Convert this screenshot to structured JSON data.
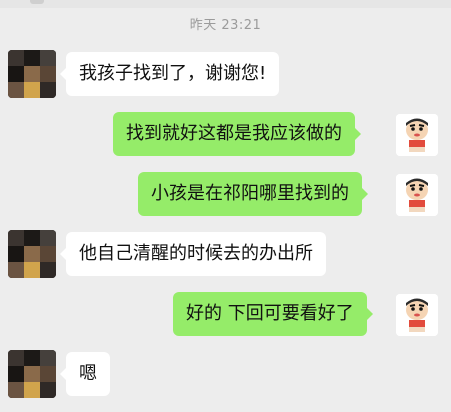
{
  "chat": {
    "timestamp": "昨天 23:21",
    "messages": [
      {
        "side": "in",
        "text": "我孩子找到了，谢谢您!"
      },
      {
        "side": "out",
        "text": "找到就好这都是我应该做的"
      },
      {
        "side": "out",
        "text": "小孩是在祁阳哪里找到的"
      },
      {
        "side": "in",
        "text": "他自己清醒的时候去的办出所"
      },
      {
        "side": "out",
        "text": "好的 下回可要看好了"
      },
      {
        "side": "in",
        "text": "嗯"
      }
    ]
  },
  "avatars": {
    "contact": {
      "icon": "pixelated-avatar-icon"
    },
    "self": {
      "icon": "crayon-shinchan-avatar-icon"
    }
  },
  "colors": {
    "background": "#ededed",
    "incoming_bubble": "#ffffff",
    "outgoing_bubble": "#95ec69",
    "timestamp_text": "#9b9b9b"
  }
}
